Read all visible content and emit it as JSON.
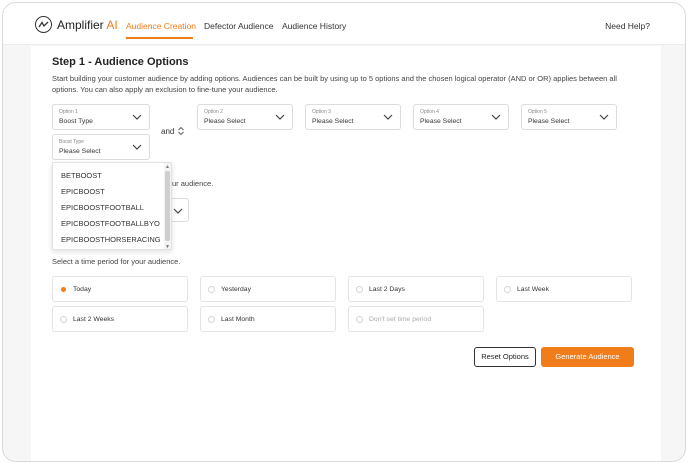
{
  "header": {
    "brand": "Amplifier",
    "brand_suffix": "AI",
    "tabs": [
      {
        "label": "Audience Creation",
        "active": true
      },
      {
        "label": "Defector Audience",
        "active": false
      },
      {
        "label": "Audience History",
        "active": false
      }
    ],
    "help": "Need Help?"
  },
  "step": {
    "title": "Step 1 - Audience Options",
    "description": "Start building your customer audience by adding options. Audiences can be built by using up to 5 options and the chosen logical operator (AND or OR) applies between all options. You can also apply an exclusion to fine-tune your audience."
  },
  "options": [
    {
      "label": "Option 1",
      "value": "Boost Type"
    },
    {
      "label": "Option 2",
      "value": "Please Select"
    },
    {
      "label": "Option 3",
      "value": "Please Select"
    },
    {
      "label": "Option 4",
      "value": "Please Select"
    },
    {
      "label": "Option 5",
      "value": "Please Select"
    }
  ],
  "operator": "and",
  "sub_option": {
    "label": "Boost Type",
    "value": "Please Select"
  },
  "dropdown_items": [
    "BETBOOST",
    "EPICBOOST",
    "EPICBOOSTFOOTBALL",
    "EPICBOOSTFOOTBALLBYO",
    "EPICBOOSTHORSERACING"
  ],
  "partial_text": "ur audience.",
  "time_period": {
    "label": "Select a time period for your audience.",
    "options": [
      {
        "label": "Today",
        "selected": true,
        "disabled": false
      },
      {
        "label": "Yesterday",
        "selected": false,
        "disabled": false
      },
      {
        "label": "Last 2 Days",
        "selected": false,
        "disabled": false
      },
      {
        "label": "Last Week",
        "selected": false,
        "disabled": false
      },
      {
        "label": "Last 2 Weeks",
        "selected": false,
        "disabled": false
      },
      {
        "label": "Last Month",
        "selected": false,
        "disabled": false
      },
      {
        "label": "Don't set time period",
        "selected": false,
        "disabled": true
      }
    ]
  },
  "buttons": {
    "reset": "Reset Options",
    "generate": "Generate Audience"
  },
  "colors": {
    "accent": "#f07c1a",
    "border": "#dcdcdc"
  }
}
